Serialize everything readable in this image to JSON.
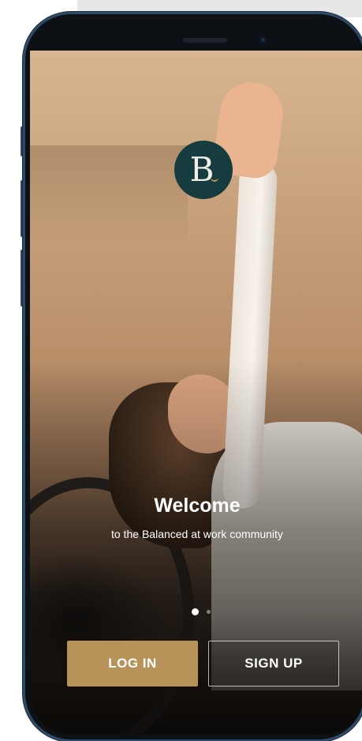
{
  "app": {
    "logo_letter": "B",
    "brand_color": "#163c40",
    "accent_color": "#b7935a"
  },
  "welcome": {
    "title": "Welcome",
    "subtitle": "to the Balanced at work community"
  },
  "pager": {
    "current_page": 1,
    "total_pages": 2
  },
  "actions": {
    "login_label": "LOG IN",
    "signup_label": "SIGN UP"
  }
}
